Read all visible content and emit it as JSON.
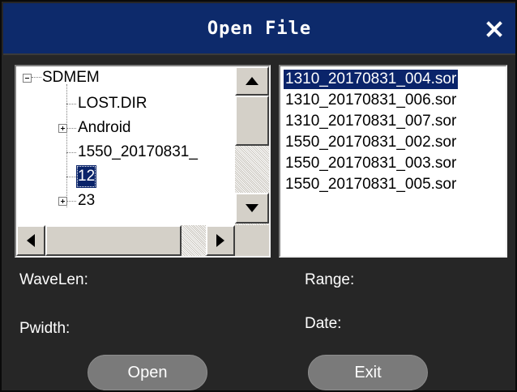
{
  "window": {
    "title": "Open File",
    "close_icon": "close-icon"
  },
  "colors": {
    "titlebar": "#0d2a6b",
    "background": "#262626",
    "selection": "#0a246a",
    "button": "#7a7a7a"
  },
  "tree": {
    "items": [
      {
        "label": "SDMEM",
        "expander": "minus",
        "level": 0
      },
      {
        "label": "LOST.DIR",
        "expander": "none",
        "level": 1
      },
      {
        "label": "Android",
        "expander": "plus",
        "level": 1
      },
      {
        "label": "1550_20170831_",
        "expander": "none",
        "level": 1
      },
      {
        "label": "12",
        "expander": "none",
        "level": 1,
        "selected": true
      },
      {
        "label": "23",
        "expander": "plus",
        "level": 1
      }
    ]
  },
  "files": {
    "items": [
      {
        "label": "1310_20170831_004.sor",
        "selected": true
      },
      {
        "label": "1310_20170831_006.sor"
      },
      {
        "label": "1310_20170831_007.sor"
      },
      {
        "label": "1550_20170831_002.sor"
      },
      {
        "label": "1550_20170831_003.sor"
      },
      {
        "label": "1550_20170831_005.sor"
      }
    ]
  },
  "info": {
    "wavelen_label": "WaveLen:",
    "range_label": "Range:",
    "pwidth_label": "Pwidth:",
    "date_label": "Date:"
  },
  "buttons": {
    "open_label": "Open",
    "exit_label": "Exit"
  }
}
